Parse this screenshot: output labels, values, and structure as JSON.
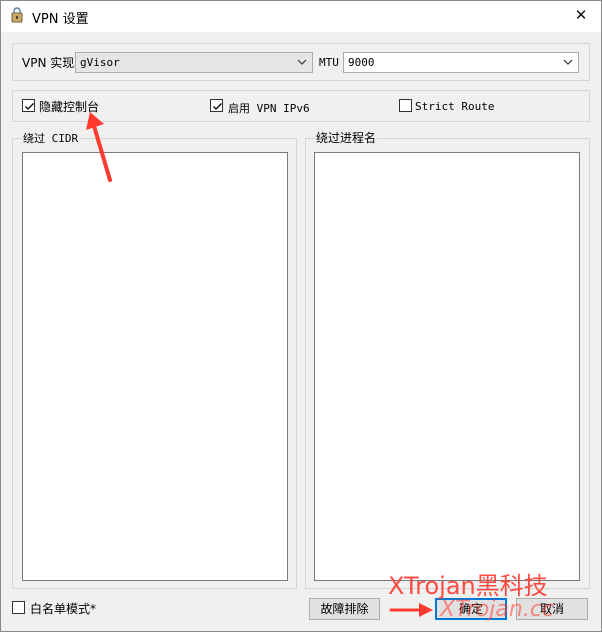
{
  "window": {
    "title": "VPN 设置",
    "close_glyph": "✕"
  },
  "impl": {
    "label": "VPN 实现",
    "value": "gVisor"
  },
  "mtu": {
    "label": "MTU",
    "value": "9000"
  },
  "options": {
    "hide_console": {
      "label": "隐藏控制台",
      "checked": true
    },
    "enable_ipv6": {
      "label": "启用 VPN IPv6",
      "checked": true
    },
    "strict_route": {
      "label": "Strict Route",
      "checked": false
    }
  },
  "bypass_cidr": {
    "label": "绕过 CIDR"
  },
  "bypass_process": {
    "label": "绕过进程名"
  },
  "whitelist": {
    "label": "白名单模式*",
    "checked": false
  },
  "buttons": {
    "troubleshoot": "故障排除",
    "ok": "确定",
    "cancel": "取消"
  },
  "watermark": {
    "line1": "XTrojan黑科技",
    "line2": "XTrojan.cc"
  },
  "colors": {
    "accent": "#0078d7",
    "annotation": "#ff3b30"
  },
  "icons": [
    "app-icon",
    "close-icon",
    "chevron-down-icon",
    "checkmark-icon",
    "arrow-annotation-icon"
  ]
}
